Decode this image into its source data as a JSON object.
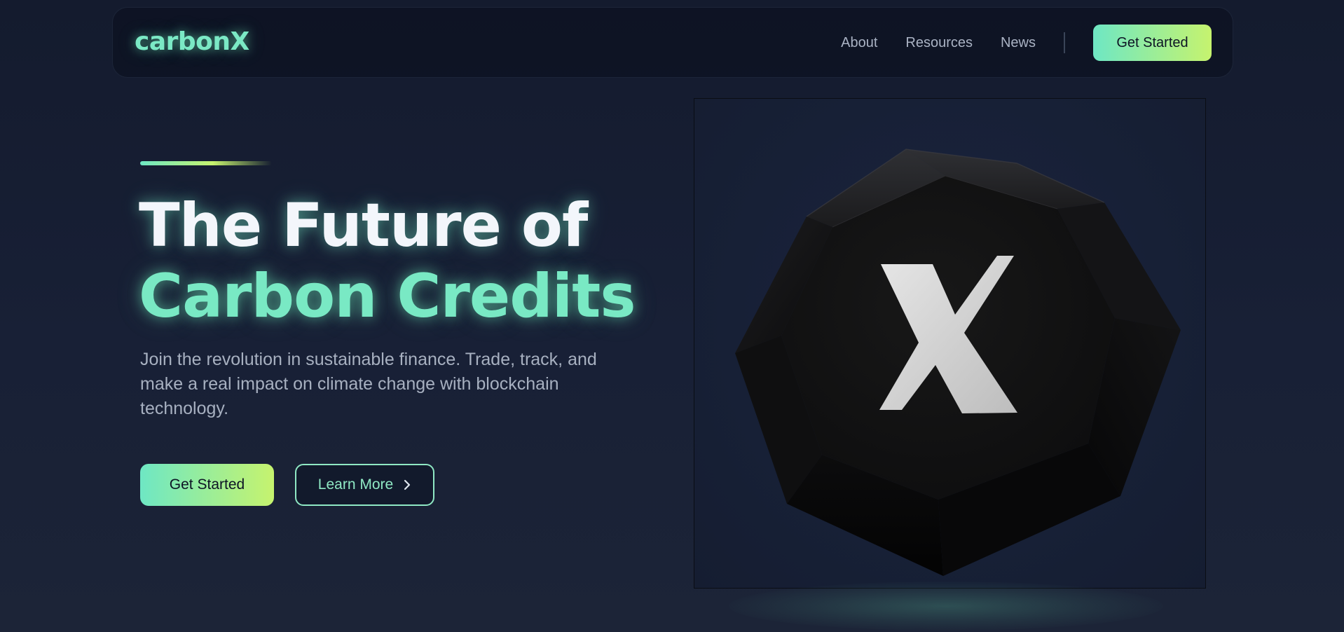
{
  "navbar": {
    "logo": "carbonX",
    "links": [
      {
        "label": "About"
      },
      {
        "label": "Resources"
      },
      {
        "label": "News"
      }
    ],
    "cta_label": "Get Started"
  },
  "hero": {
    "title_line1": "The Future of",
    "title_line2": "Carbon Credits",
    "subtitle": "Join the revolution in sustainable finance. Trade, track, and make a real impact on climate change with blockchain technology.",
    "primary_button": "Get Started",
    "secondary_button": "Learn More",
    "image": {
      "subject": "black faceted polyhedron with white X",
      "icon": "chevron-right-icon"
    }
  },
  "colors": {
    "background": "#182036",
    "accent_green": "#6ee7c4",
    "accent_lime": "#c6f36e",
    "text_primary": "#f3f6fb",
    "text_muted": "#a7b0c0"
  }
}
